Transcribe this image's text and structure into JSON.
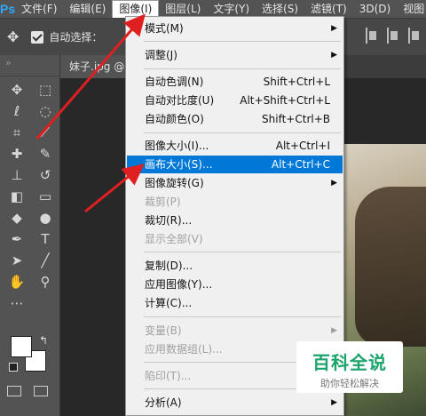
{
  "app": {
    "logo": "Ps"
  },
  "menubar": {
    "items": [
      "文件(F)",
      "编辑(E)",
      "图像(I)",
      "图层(L)",
      "文字(Y)",
      "选择(S)",
      "滤镜(T)",
      "3D(D)",
      "视图"
    ],
    "active_index": 2
  },
  "options": {
    "autoselect_label": "自动选择："
  },
  "tab": {
    "label": "妹子.jpg @"
  },
  "menu": {
    "items": [
      {
        "label": "模式(M)",
        "shortcut": "",
        "submenu": true,
        "disabled": false
      },
      {
        "label": "调整(J)",
        "shortcut": "",
        "submenu": true,
        "disabled": false
      },
      {
        "label": "自动色调(N)",
        "shortcut": "Shift+Ctrl+L",
        "submenu": false,
        "disabled": false
      },
      {
        "label": "自动对比度(U)",
        "shortcut": "Alt+Shift+Ctrl+L",
        "submenu": false,
        "disabled": false
      },
      {
        "label": "自动颜色(O)",
        "shortcut": "Shift+Ctrl+B",
        "submenu": false,
        "disabled": false
      },
      {
        "label": "图像大小(I)...",
        "shortcut": "Alt+Ctrl+I",
        "submenu": false,
        "disabled": false
      },
      {
        "label": "画布大小(S)...",
        "shortcut": "Alt+Ctrl+C",
        "submenu": false,
        "disabled": false,
        "highlighted": true
      },
      {
        "label": "图像旋转(G)",
        "shortcut": "",
        "submenu": true,
        "disabled": false
      },
      {
        "label": "裁剪(P)",
        "shortcut": "",
        "submenu": false,
        "disabled": true
      },
      {
        "label": "裁切(R)...",
        "shortcut": "",
        "submenu": false,
        "disabled": false
      },
      {
        "label": "显示全部(V)",
        "shortcut": "",
        "submenu": false,
        "disabled": true
      },
      {
        "label": "复制(D)...",
        "shortcut": "",
        "submenu": false,
        "disabled": false
      },
      {
        "label": "应用图像(Y)...",
        "shortcut": "",
        "submenu": false,
        "disabled": false
      },
      {
        "label": "计算(C)...",
        "shortcut": "",
        "submenu": false,
        "disabled": false
      },
      {
        "label": "变量(B)",
        "shortcut": "",
        "submenu": true,
        "disabled": true
      },
      {
        "label": "应用数据组(L)...",
        "shortcut": "",
        "submenu": false,
        "disabled": true
      },
      {
        "label": "陷印(T)...",
        "shortcut": "",
        "submenu": false,
        "disabled": true
      },
      {
        "label": "分析(A)",
        "shortcut": "",
        "submenu": true,
        "disabled": false
      }
    ]
  },
  "watermark": {
    "title": "百科全说",
    "subtitle": "助你轻松解决"
  },
  "colors": {
    "highlight": "#0078d7",
    "annotation_arrow": "#e02020",
    "watermark_green": "#1aa36a",
    "ps_blue": "#31a8ff"
  }
}
